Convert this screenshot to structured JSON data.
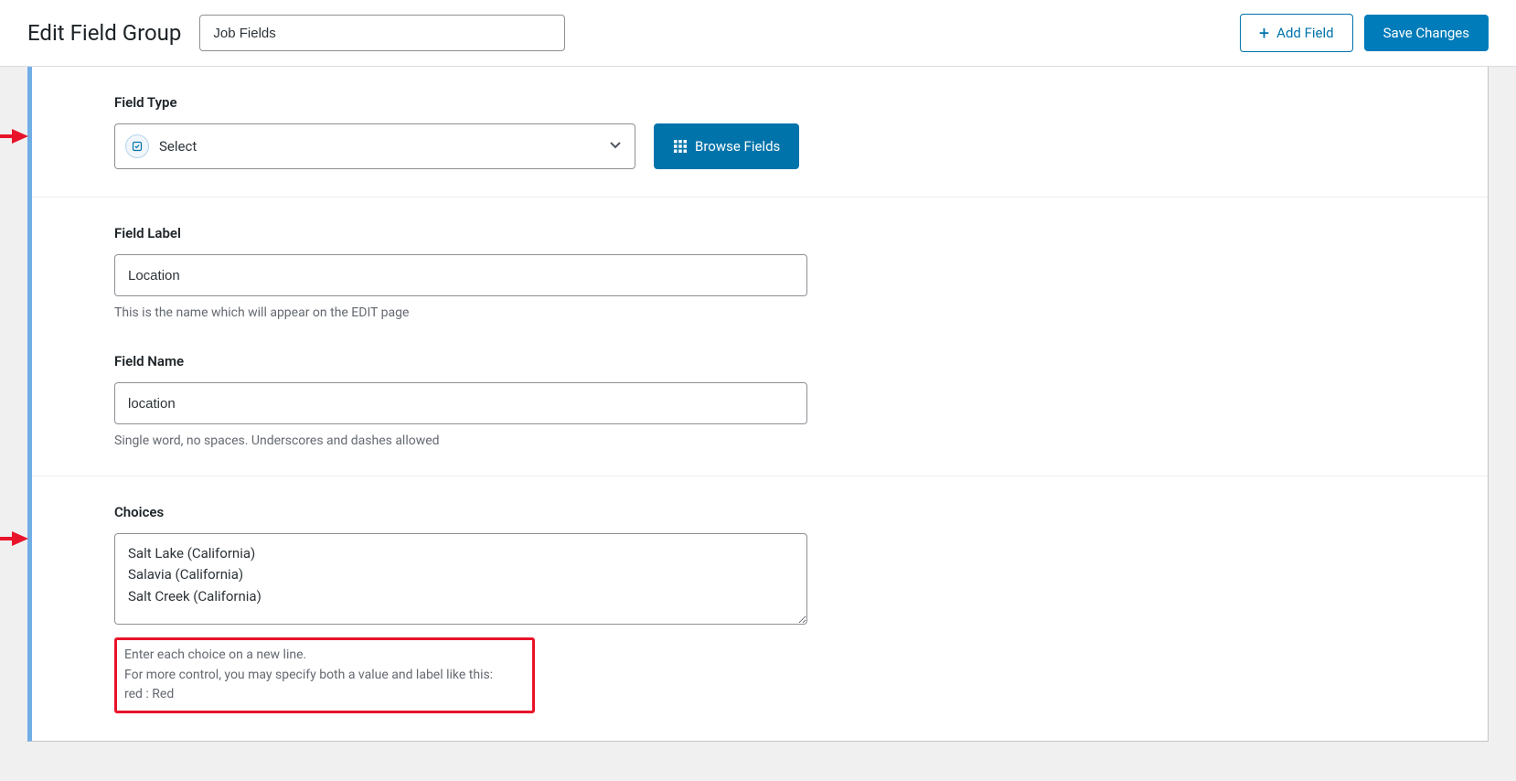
{
  "header": {
    "page_title": "Edit Field Group",
    "group_name": "Job Fields",
    "add_field_label": "Add Field",
    "save_label": "Save Changes"
  },
  "field_type": {
    "label": "Field Type",
    "value": "Select",
    "browse_label": "Browse Fields"
  },
  "field_label": {
    "label": "Field Label",
    "value": "Location",
    "help": "This is the name which will appear on the EDIT page"
  },
  "field_name": {
    "label": "Field Name",
    "value": "location",
    "help": "Single word, no spaces. Underscores and dashes allowed"
  },
  "choices": {
    "label": "Choices",
    "value": "Salt Lake (California)\nSalavia (California)\nSalt Creek (California)",
    "help_line1": "Enter each choice on a new line.",
    "help_line2": "For more control, you may specify both a value and label like this:",
    "help_line3": "red : Red"
  }
}
